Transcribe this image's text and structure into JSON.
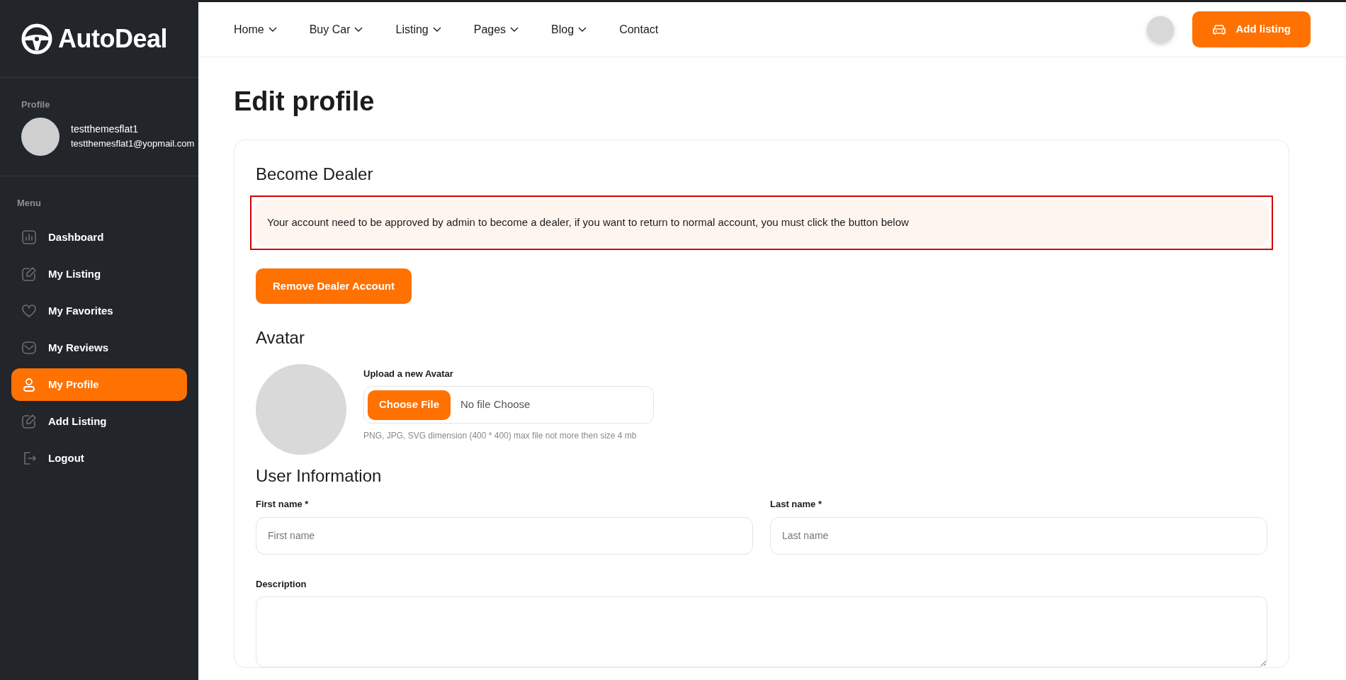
{
  "logo": {
    "text": "AutoDeal"
  },
  "sidebar": {
    "profile_label": "Profile",
    "user_name": "testthemesflat1",
    "user_email": "testthemesflat1@yopmail.com",
    "menu_label": "Menu",
    "items": [
      {
        "label": "Dashboard",
        "selected": false
      },
      {
        "label": "My Listing",
        "selected": false
      },
      {
        "label": "My Favorites",
        "selected": false
      },
      {
        "label": "My Reviews",
        "selected": false
      },
      {
        "label": "My Profile",
        "selected": true
      },
      {
        "label": "Add Listing",
        "selected": false
      },
      {
        "label": "Logout",
        "selected": false
      }
    ]
  },
  "nav": {
    "items": [
      {
        "label": "Home",
        "dropdown": true
      },
      {
        "label": "Buy Car",
        "dropdown": true
      },
      {
        "label": "Listing",
        "dropdown": true
      },
      {
        "label": "Pages",
        "dropdown": true
      },
      {
        "label": "Blog",
        "dropdown": true
      },
      {
        "label": "Contact",
        "dropdown": false
      }
    ],
    "add_button": "Add listing"
  },
  "page_title": "Edit profile",
  "dealer": {
    "heading": "Become Dealer",
    "notice": "Your account need to be approved by admin to become a dealer, if you want to return to normal account, you must click the button below",
    "button": "Remove Dealer Account"
  },
  "avatar": {
    "heading": "Avatar",
    "upload_label": "Upload a new Avatar",
    "choose_button": "Choose File",
    "file_status": "No file Choose",
    "hint": "PNG, JPG, SVG dimension (400 * 400) max file not more then size 4 mb"
  },
  "user_info": {
    "heading": "User Information",
    "fields": [
      {
        "label": "First name *",
        "placeholder": "First name"
      },
      {
        "label": "Last name *",
        "placeholder": "Last name"
      }
    ],
    "description_label": "Description"
  }
}
